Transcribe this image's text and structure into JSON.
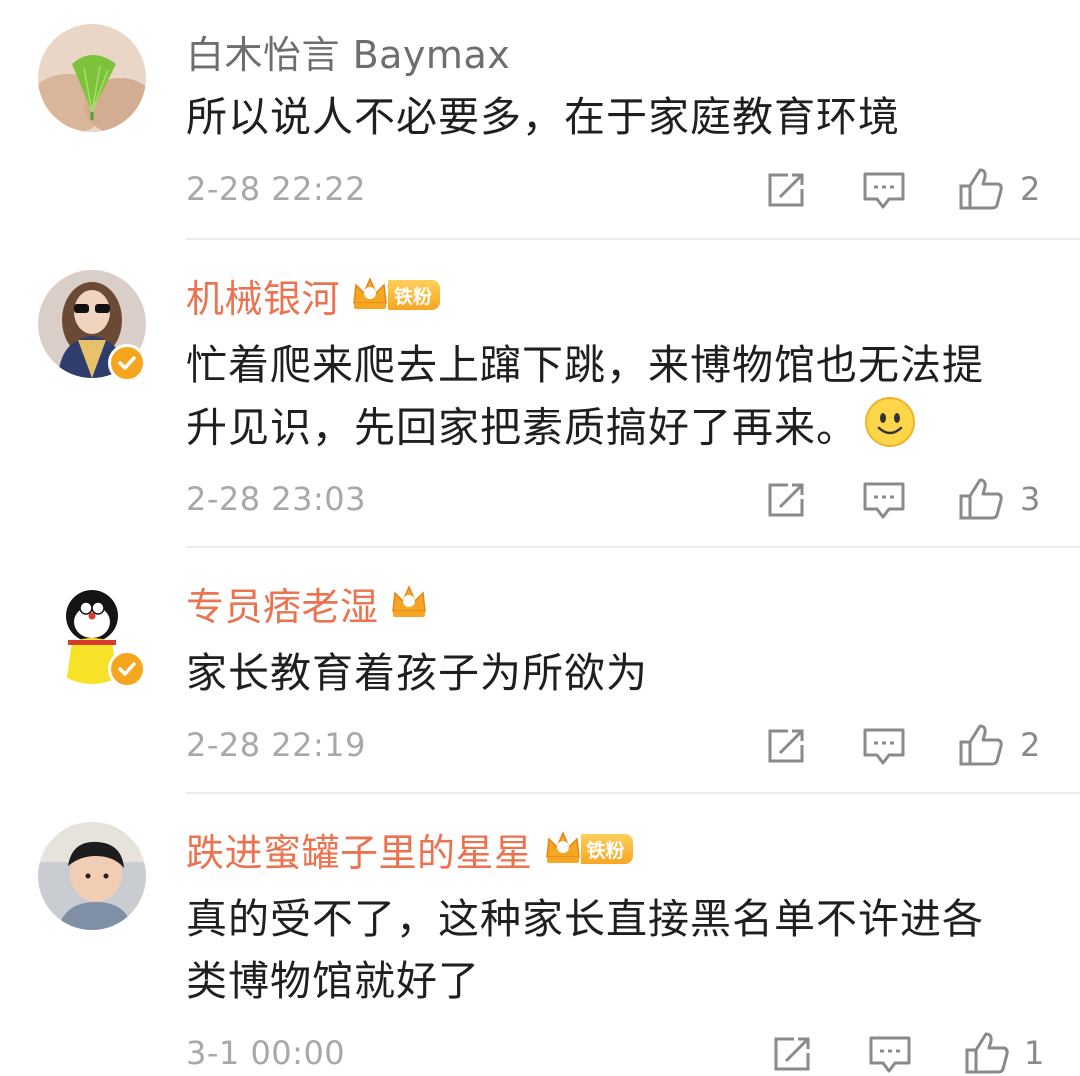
{
  "comments": [
    {
      "username": "白木怡言 Baymax",
      "text_lines": [
        "所以说人不必要多，在于家庭教育环境"
      ],
      "time": "2-28 22:22",
      "likes": "2",
      "verified": false,
      "crown_level": null,
      "fan_badge": null,
      "avatar": "ginkgo-leaf-avatar"
    },
    {
      "username": "机械银河",
      "text_lines": [
        "忙着爬来爬去上蹿下跳，来博物馆也无法提",
        "升见识，先回家把素质搞好了再来。"
      ],
      "emoji": "smile-emoji",
      "time": "2-28 23:03",
      "likes": "3",
      "verified": true,
      "crown_level": "4",
      "fan_badge": "铁粉",
      "avatar": "sunglasses-woman-avatar"
    },
    {
      "username": "专员痞老湿",
      "text_lines": [
        "家长教育着孩子为所欲为"
      ],
      "time": "2-28 22:19",
      "likes": "2",
      "verified": true,
      "crown_level": "5",
      "fan_badge": null,
      "avatar": "doraemon-avatar"
    },
    {
      "username": "跌进蜜罐子里的星星",
      "text_lines": [
        "真的受不了，这种家长直接黑名单不许进各",
        "类博物馆就好了"
      ],
      "time": "3-1 00:00",
      "likes": "1",
      "verified": false,
      "crown_level": "5",
      "fan_badge": "铁粉",
      "avatar": "child-photo-avatar"
    }
  ],
  "icons": {
    "repost": "repost-icon",
    "comment": "comment-icon",
    "like": "thumbs-up-icon",
    "verified": "verified-check-icon",
    "crown": "crown-badge-icon"
  },
  "colors": {
    "username": "#eb7350",
    "plain_username": "#6e6e6e",
    "time": "#a8a8a8",
    "badge_gold": "#f6a623"
  }
}
